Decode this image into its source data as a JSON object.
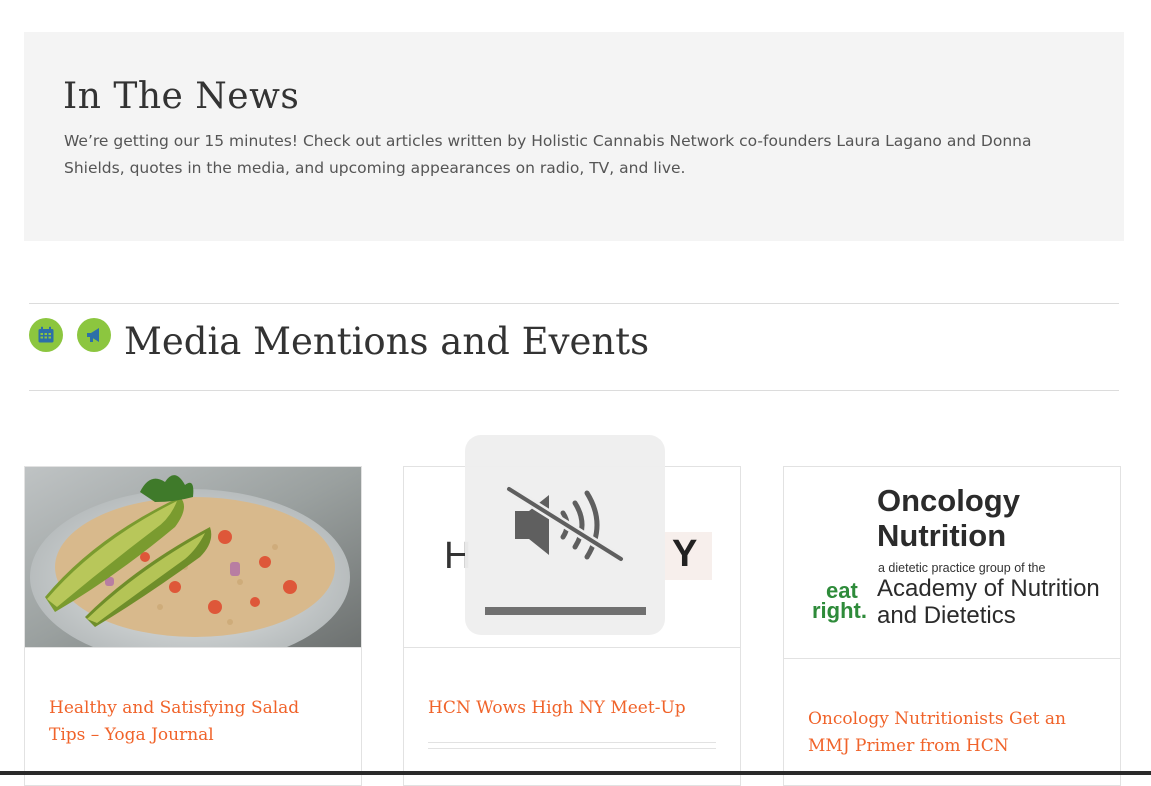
{
  "hero": {
    "title": "In The News",
    "description": "We’re getting our 15 minutes! Check out articles written by Holistic Cannabis Network co-founders Laura Lagano and Donna Shields, quotes in the media, and upcoming appearances on radio, TV, and live."
  },
  "section": {
    "title": "Media Mentions and Events",
    "icons": [
      "calendar-icon",
      "megaphone-icon"
    ]
  },
  "cards": [
    {
      "title": "Healthy and Satisfying Salad Tips – Yoga Journal",
      "image": "quinoa-avocado-salad-photo"
    },
    {
      "title": "HCN Wows High NY Meet-Up",
      "image_text_left": "H",
      "image_text_right": "Y"
    },
    {
      "title": "Oncology Nutritionists Get an MMJ Primer from HCN",
      "logo": {
        "line1": "Oncology",
        "line2": "Nutrition",
        "sub": "a dietetic practice group of the",
        "academy1": "Academy of Nutrition",
        "academy2": "and Dietetics",
        "eat": "eat",
        "right": "right."
      }
    }
  ],
  "overlay": {
    "icon": "speaker-muted-icon",
    "volume_level": 0
  },
  "colors": {
    "accent": "#8cc63f",
    "link": "#f0632a",
    "hero_bg": "#f4f4f4"
  }
}
